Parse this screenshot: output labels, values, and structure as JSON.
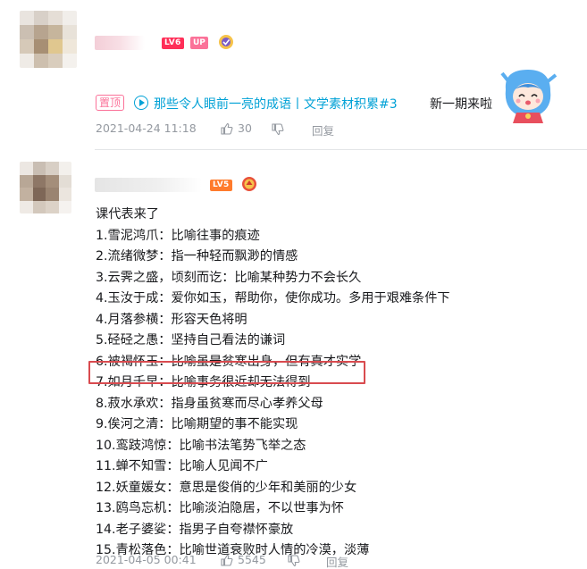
{
  "comments": [
    {
      "level": "LV6",
      "up_badge": "UP",
      "pinned_label": "置顶",
      "link_text": "那些令人眼前一亮的成语丨文学素材积累#3",
      "trailing_text": "新一期来啦",
      "timestamp": "2021-04-24 11:18",
      "likes": "30",
      "reply_label": "回复"
    },
    {
      "level": "LV5",
      "lines": [
        "课代表来了",
        "1.雪泥鸿爪：比喻往事的痕迹",
        "2.流绪微梦：指一种轻而飘渺的情感",
        "3.云霁之盛，顷刻而讫：比喻某种势力不会长久",
        "4.玉汝于成：爱你如玉，帮助你，使你成功。多用于艰难条件下",
        "4.月落参横：形容天色将明",
        "5.硁硁之愚：坚持自己看法的谦词",
        "6.被褐怀玉：比喻虽是贫寒出身，但有真才实学",
        "7.如月千早：比喻事务很近却无法得到",
        "8.菽水承欢：指身虽贫寒而尽心孝养父母",
        "9.俟河之清：比喻期望的事不能实现",
        "10.鸾跂鸿惊：比喻书法笔势飞举之态",
        "11.蝉不知雪：比喻人见闻不广",
        "12.妖童媛女：意思是俊俏的少年和美丽的少女",
        "13.鸥鸟忘机：比喻淡泊隐居，不以世事为怀",
        "14.老子婆娑：指男子自夸襟怀豪放",
        "15.青松落色：比喻世道衰败时人情的冷漠，淡薄"
      ],
      "timestamp": "2021-04-05 00:41",
      "likes": "5545",
      "reply_label": "回复"
    }
  ],
  "colors": {
    "link": "#00a1d6",
    "pink": "#fb7299",
    "meta": "#9499a0",
    "highlight": "#d94b4f"
  }
}
